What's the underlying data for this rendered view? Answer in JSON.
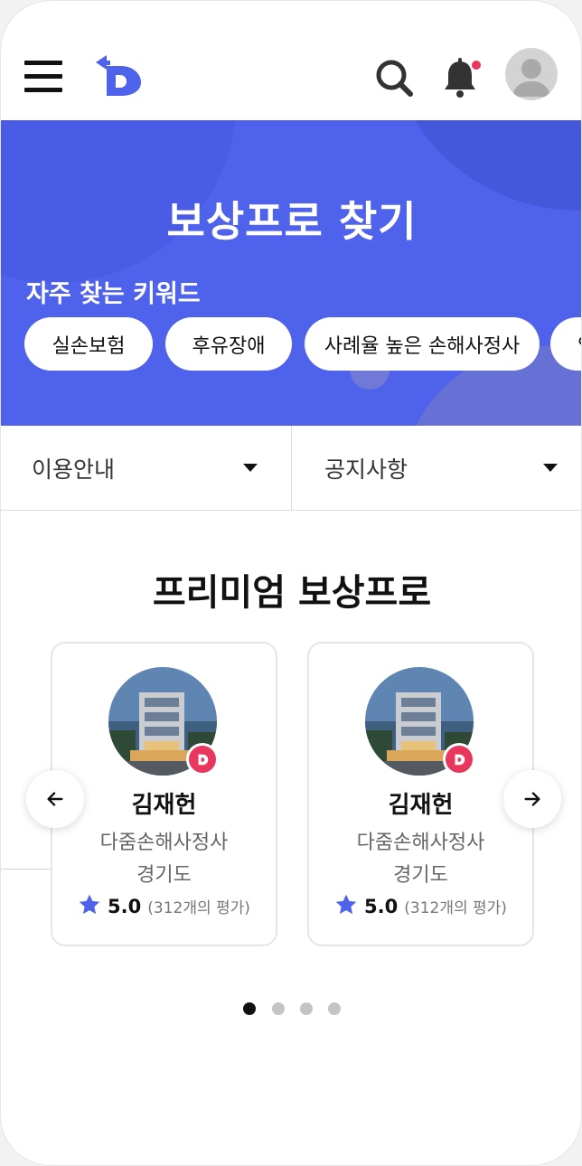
{
  "header": {
    "menu_icon": "hamburger-menu-icon",
    "logo_icon": "brand-d-logo-icon",
    "search_icon": "search-icon",
    "bell_icon": "notification-bell-icon",
    "notification_dot_color": "#e8365d",
    "avatar_icon": "user-avatar-icon",
    "brand_color": "#4f62ec"
  },
  "hero": {
    "title": "보상프로 찾기",
    "keywords_label": "자주 찾는 키워드",
    "keywords": [
      "실손보험",
      "후유장애",
      "사례율 높은 손해사정사",
      "입"
    ]
  },
  "dropdowns": [
    {
      "label": "이용안내"
    },
    {
      "label": "공지사항"
    }
  ],
  "premium": {
    "title": "프리미엄 보상프로",
    "cards": [
      {
        "name": "김재헌",
        "company": "다줌손해사정사",
        "region": "경기도",
        "score": "5.0",
        "reviews": "(312개의 평가)"
      },
      {
        "name": "김재헌",
        "company": "다줌손해사정사",
        "region": "경기도",
        "score": "5.0",
        "reviews": "(312개의 평가)"
      }
    ],
    "prev_icon": "arrow-left-icon",
    "next_icon": "arrow-right-icon",
    "pagination": {
      "total": 4,
      "active": 1
    },
    "badge_color": "#e8365d",
    "star_color": "#4f62ec"
  }
}
